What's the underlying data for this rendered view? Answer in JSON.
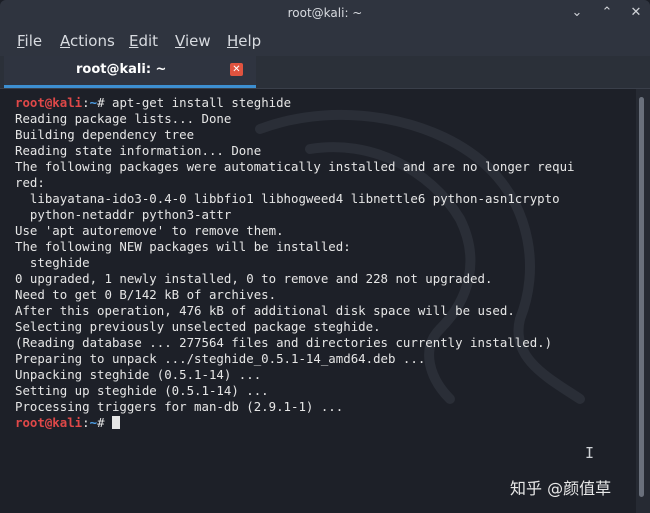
{
  "window": {
    "title": "root@kali: ~"
  },
  "controls": {
    "minimize": "⌄",
    "restore": "⌃",
    "close": "✕"
  },
  "menu": [
    {
      "underline": "F",
      "rest": "ile"
    },
    {
      "underline": "A",
      "rest": "ctions"
    },
    {
      "underline": "E",
      "rest": "dit"
    },
    {
      "underline": "V",
      "rest": "iew"
    },
    {
      "underline": "H",
      "rest": "elp"
    }
  ],
  "tab": {
    "label": "root@kali: ~",
    "close_icon": "✕"
  },
  "prompt": {
    "user_host": "root@kali",
    "sep": ":",
    "path": "~",
    "symbol": "# "
  },
  "terminal": {
    "command": "apt-get install steghide",
    "output": [
      "Reading package lists... Done",
      "Building dependency tree",
      "Reading state information... Done",
      "The following packages were automatically installed and are no longer requi",
      "red:",
      "  libayatana-ido3-0.4-0 libbfio1 libhogweed4 libnettle6 python-asn1crypto",
      "  python-netaddr python3-attr",
      "Use 'apt autoremove' to remove them.",
      "The following NEW packages will be installed:",
      "  steghide",
      "0 upgraded, 1 newly installed, 0 to remove and 228 not upgraded.",
      "Need to get 0 B/142 kB of archives.",
      "After this operation, 476 kB of additional disk space will be used.",
      "Selecting previously unselected package steghide.",
      "(Reading database ... 277564 files and directories currently installed.)",
      "Preparing to unpack .../steghide_0.5.1-14_amd64.deb ...",
      "Unpacking steghide (0.5.1-14) ...",
      "Setting up steghide (0.5.1-14) ...",
      "Processing triggers for man-db (2.9.1-1) ..."
    ]
  },
  "watermark": {
    "text": "知乎 @颜值草"
  },
  "icons": {
    "ibeam": "I"
  }
}
